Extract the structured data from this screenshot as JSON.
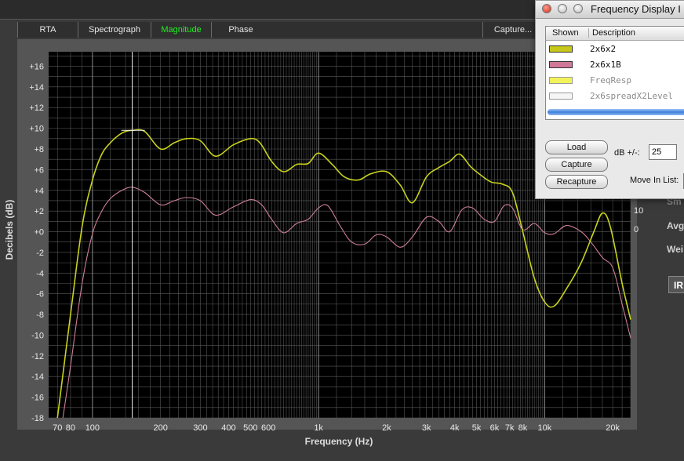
{
  "tabs": [
    {
      "label": "RTA",
      "active": false
    },
    {
      "label": "Spectrograph",
      "active": false
    },
    {
      "label": "Magnitude",
      "active": true
    },
    {
      "label": "Phase",
      "active": false
    },
    {
      "label": "Capture...",
      "active": false
    }
  ],
  "axes": {
    "ylabel": "Decibels (dB)",
    "xlabel": "Frequency (Hz)",
    "y_ticks": [
      "+16",
      "+14",
      "+12",
      "+10",
      "+8",
      "+6",
      "+4",
      "+2",
      "+0",
      "-2",
      "-4",
      "-6",
      "-8",
      "-10",
      "-12",
      "-14",
      "-16",
      "-18"
    ],
    "x_ticks": [
      "70",
      "80",
      "100",
      "200",
      "300",
      "400",
      "500",
      "600",
      "1k",
      "2k",
      "3k",
      "4k",
      "5k",
      "6k",
      "7k",
      "8k",
      "10k",
      "20k"
    ],
    "right_ticks": [
      "10",
      "0"
    ]
  },
  "chart_data": {
    "type": "line",
    "x_scale": "log",
    "xlim": [
      64,
      24000
    ],
    "ylim": [
      -18,
      17.4
    ],
    "grid": true,
    "cursor_hz": 150,
    "series": [
      {
        "name": "2x6x2",
        "color": "#c8d21c",
        "points": [
          [
            70,
            -18
          ],
          [
            80,
            -8
          ],
          [
            90,
            0.5
          ],
          [
            100,
            5
          ],
          [
            110,
            7.5
          ],
          [
            120,
            8.6
          ],
          [
            130,
            9.3
          ],
          [
            140,
            9.7
          ],
          [
            150,
            9.8
          ],
          [
            170,
            9.7
          ],
          [
            200,
            8.0
          ],
          [
            230,
            8.6
          ],
          [
            260,
            9.0
          ],
          [
            300,
            8.8
          ],
          [
            350,
            7.3
          ],
          [
            420,
            8.4
          ],
          [
            500,
            9.0
          ],
          [
            550,
            8.6
          ],
          [
            620,
            6.8
          ],
          [
            700,
            5.8
          ],
          [
            800,
            6.5
          ],
          [
            900,
            6.6
          ],
          [
            1000,
            7.6
          ],
          [
            1150,
            6.5
          ],
          [
            1300,
            5.3
          ],
          [
            1500,
            5.0
          ],
          [
            1700,
            5.6
          ],
          [
            2000,
            5.8
          ],
          [
            2300,
            4.5
          ],
          [
            2600,
            2.8
          ],
          [
            3000,
            5.3
          ],
          [
            3400,
            6.2
          ],
          [
            3800,
            6.8
          ],
          [
            4200,
            7.5
          ],
          [
            4700,
            6.3
          ],
          [
            5200,
            5.5
          ],
          [
            5800,
            4.8
          ],
          [
            6500,
            4.6
          ],
          [
            7200,
            3.8
          ],
          [
            8000,
            0
          ],
          [
            9000,
            -4.5
          ],
          [
            10000,
            -6.8
          ],
          [
            11000,
            -7.2
          ],
          [
            12500,
            -5.5
          ],
          [
            14500,
            -3
          ],
          [
            16500,
            0
          ],
          [
            18000,
            1.8
          ],
          [
            19500,
            0.5
          ],
          [
            22000,
            -5
          ],
          [
            24000,
            -8.5
          ]
        ]
      },
      {
        "name": "2x6x1B",
        "color": "#cc7f96",
        "points": [
          [
            74,
            -18
          ],
          [
            80,
            -13
          ],
          [
            90,
            -5
          ],
          [
            100,
            -0.2
          ],
          [
            110,
            2
          ],
          [
            120,
            3.2
          ],
          [
            135,
            4
          ],
          [
            150,
            4.3
          ],
          [
            170,
            3.8
          ],
          [
            200,
            2.6
          ],
          [
            230,
            3
          ],
          [
            260,
            3.3
          ],
          [
            300,
            3
          ],
          [
            350,
            1.6
          ],
          [
            420,
            2.4
          ],
          [
            500,
            3.1
          ],
          [
            560,
            2.6
          ],
          [
            620,
            1.2
          ],
          [
            700,
            -0.1
          ],
          [
            800,
            0.8
          ],
          [
            900,
            1.2
          ],
          [
            1000,
            2.3
          ],
          [
            1100,
            2.5
          ],
          [
            1250,
            0.5
          ],
          [
            1400,
            -1
          ],
          [
            1600,
            -1.2
          ],
          [
            1800,
            -0.3
          ],
          [
            2000,
            -0.5
          ],
          [
            2300,
            -1.5
          ],
          [
            2600,
            -0.5
          ],
          [
            3000,
            1.4
          ],
          [
            3400,
            1
          ],
          [
            3800,
            0
          ],
          [
            4300,
            2.1
          ],
          [
            4800,
            2.3
          ],
          [
            5400,
            1.2
          ],
          [
            6000,
            1
          ],
          [
            6600,
            2.5
          ],
          [
            7200,
            2.3
          ],
          [
            8000,
            0.2
          ],
          [
            9000,
            0.8
          ],
          [
            10000,
            -0.1
          ],
          [
            11000,
            -0.2
          ],
          [
            12500,
            0.6
          ],
          [
            14500,
            0
          ],
          [
            16000,
            -1
          ],
          [
            18000,
            -2.5
          ],
          [
            20000,
            -3.5
          ],
          [
            22000,
            -7
          ],
          [
            24000,
            -10.3
          ]
        ]
      }
    ]
  },
  "side_panel": {
    "labels": [
      "Sm",
      "Avg",
      "Wei"
    ],
    "ir_button": "IR"
  },
  "dialog": {
    "title": "Frequency Display I",
    "columns": [
      "Shown",
      "Description"
    ],
    "rows": [
      {
        "desc": "2x6x2",
        "color": "#c8c81a",
        "dim": false
      },
      {
        "desc": "2x6x1B",
        "color": "#d07898",
        "dim": false
      },
      {
        "desc": "FreqResp",
        "color": "#f2f25a",
        "dim": true
      },
      {
        "desc": "2x6spreadX2Level",
        "color": "#f6f6f6",
        "dim": true
      }
    ],
    "buttons": {
      "load": "Load",
      "capture": "Capture",
      "recapture": "Recapture"
    },
    "db_label": "dB +/-:",
    "db_value": "25",
    "move_label": "Move In List:"
  }
}
